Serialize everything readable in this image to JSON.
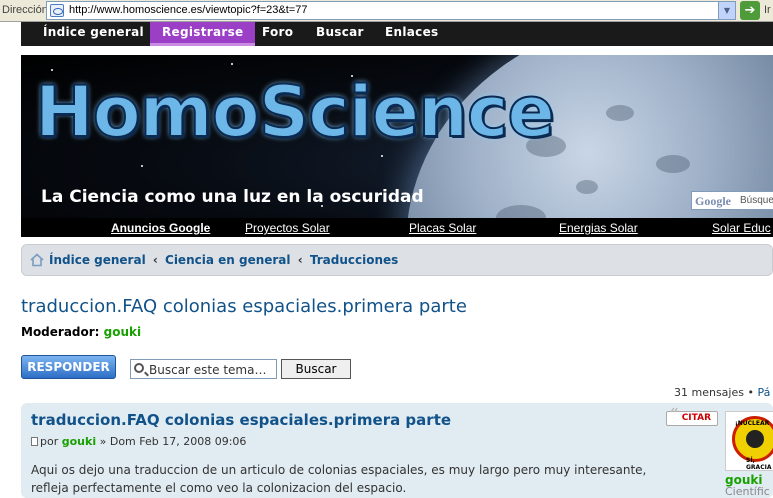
{
  "browser": {
    "address_label": "Dirección",
    "url": "http://www.homoscience.es/viewtopic?f=23&t=77",
    "go_label": "Ir"
  },
  "nav": {
    "items": [
      "Índice general",
      "Registrarse",
      "Foro",
      "Buscar",
      "Enlaces"
    ],
    "active_index": 1
  },
  "banner": {
    "logo": "HomoScience",
    "tagline": "La Ciencia como una luz en la oscuridad",
    "google_logo": "Google",
    "google_search_text": "Búsque"
  },
  "ads": {
    "items": [
      "Anuncios Google",
      "Proyectos Solar",
      "Placas Solar",
      "Energias Solar",
      "Solar Educ"
    ]
  },
  "breadcrumb": {
    "items": [
      "Índice general",
      "Ciencia en general",
      "Traducciones"
    ],
    "separator": "‹"
  },
  "topic": {
    "title": "traduccion.FAQ colonias espaciales.primera parte",
    "moderator_label": "Moderador:",
    "moderator": "gouki"
  },
  "actions": {
    "reply_label": "RESPONDER",
    "search_placeholder": "Buscar este tema…",
    "search_button": "Buscar"
  },
  "pagination": {
    "count": "31 mensajes",
    "separator": "•",
    "page_prefix": "Pá"
  },
  "post": {
    "title": "traduccion.FAQ colonias espaciales.primera parte",
    "quote_label": "CITAR",
    "by_label": "por",
    "author": "gouki",
    "date_separator": "»",
    "date": "Dom Feb 17, 2008 09:06",
    "body": "Aqui os dejo una traduccion de un articulo de colonias espaciales, es muy largo pero muy interesante, refleja perfectamente el como veo la colonizacion del espacio.",
    "profile_name": "gouki",
    "profile_rank": "Científic",
    "avatar_text_top": "¡NUCLEAR",
    "avatar_text_bottom": "SÍ, GRACIA"
  },
  "colors": {
    "link_blue": "#105289",
    "nav_active": "#9c3fc7",
    "author_green": "#18a000",
    "post_bg": "#e1ebf2"
  },
  "icons": [
    "page-icon",
    "dropdown-arrow-icon",
    "go-arrow-icon",
    "home-icon",
    "magnifier-icon",
    "post-icon",
    "quote-icon"
  ]
}
